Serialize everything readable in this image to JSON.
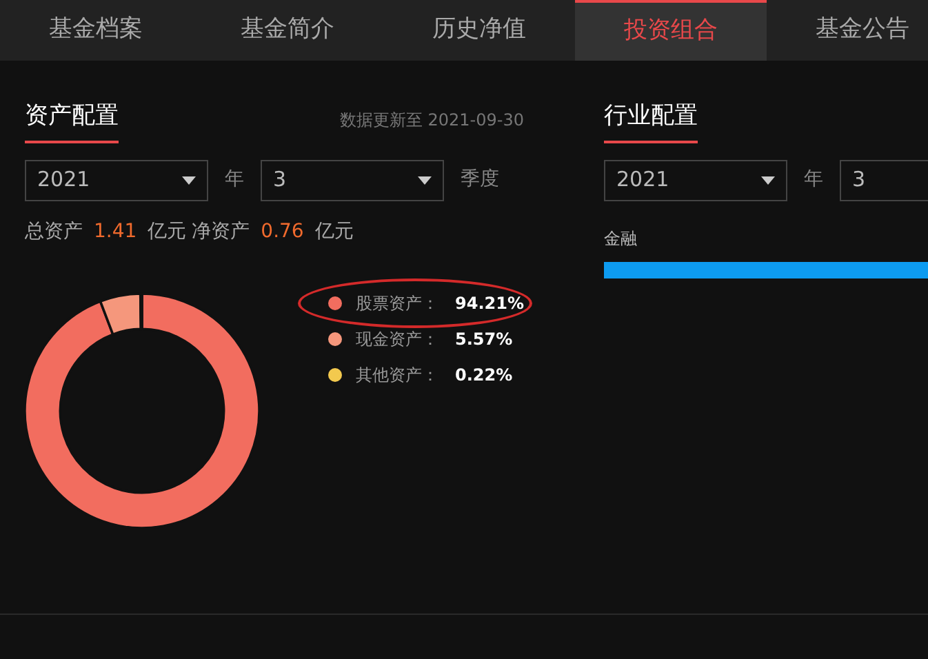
{
  "tabs": [
    {
      "label": "基金档案",
      "selected": false
    },
    {
      "label": "基金简介",
      "selected": false
    },
    {
      "label": "历史净值",
      "selected": false
    },
    {
      "label": "投资组合",
      "selected": true
    },
    {
      "label": "基金公告",
      "selected": false
    }
  ],
  "asset_allocation": {
    "title": "资产配置",
    "update_note": "数据更新至 2021-09-30",
    "year_select": "2021",
    "year_label": "年",
    "quarter_select": "3",
    "quarter_label": "季度",
    "summary": {
      "total_label": "总资产",
      "total_value": "1.41",
      "total_unit": "亿元",
      "net_label": "净资产",
      "net_value": "0.76",
      "net_unit": "亿元"
    },
    "chart_data": {
      "type": "donut",
      "categories": [
        "股票资产",
        "现金资产",
        "其他资产"
      ],
      "values": [
        94.21,
        5.57,
        0.22
      ],
      "colors": [
        "#f26d5f",
        "#f5977c",
        "#f3c94e"
      ]
    },
    "legend": [
      {
        "separator": "：",
        "value": "94.21%",
        "highlighted": true
      },
      {
        "separator": "：",
        "value": "5.57%",
        "highlighted": false
      },
      {
        "separator": "：",
        "value": "0.22%",
        "highlighted": false
      }
    ]
  },
  "industry_allocation": {
    "title": "行业配置",
    "year_select": "2021",
    "year_label": "年",
    "quarter_select": "3",
    "industries": [
      {
        "name": "金融",
        "level": 1
      }
    ]
  }
}
